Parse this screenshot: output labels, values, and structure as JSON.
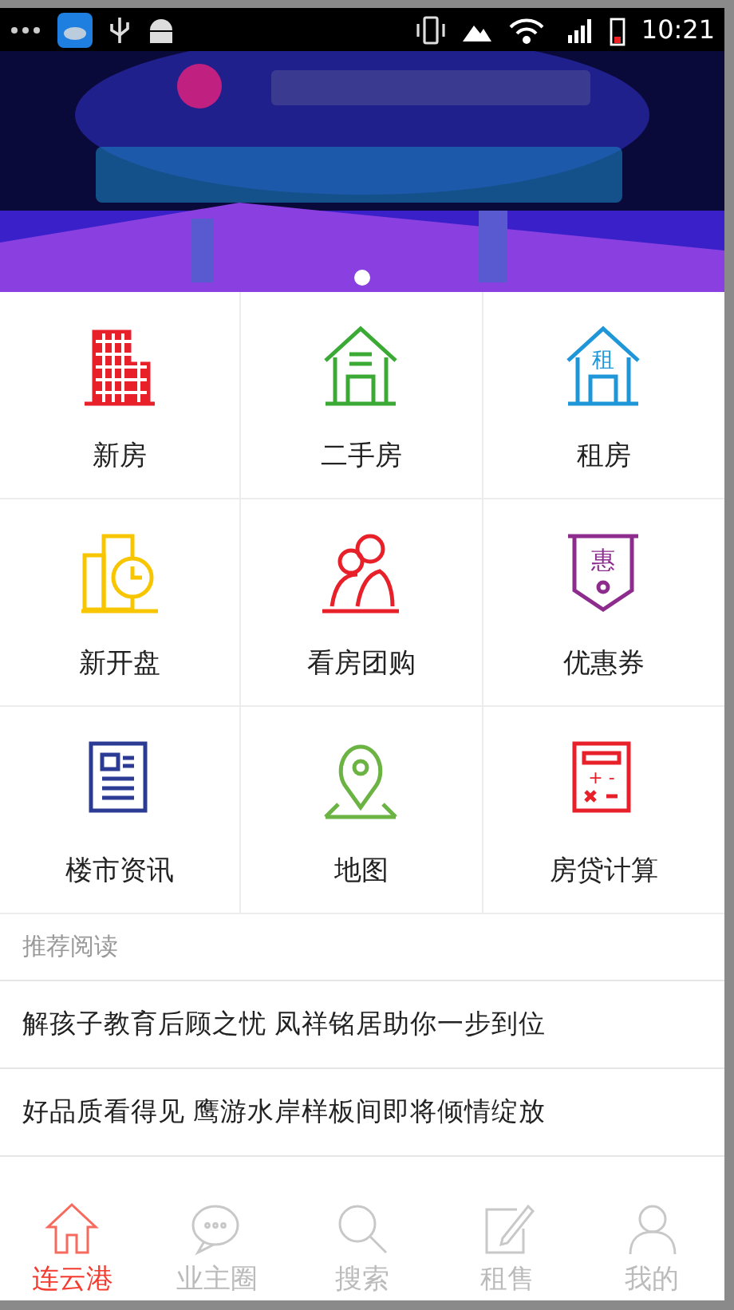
{
  "status_bar": {
    "time": "10:21"
  },
  "banner": {
    "kind": "picture",
    "pager": [
      {
        "selected": true
      }
    ]
  },
  "grid": [
    {
      "label": "新房",
      "kind": "building",
      "color": "#e8202a"
    },
    {
      "label": "二手房",
      "kind": "house",
      "color": "#3aaa35"
    },
    {
      "label": "租房",
      "kind": "rent-house",
      "color": "#1e96d8",
      "icon_text": "租"
    },
    {
      "label": "新开盘",
      "kind": "clock-building",
      "color": "#f7c600"
    },
    {
      "label": "看房团购",
      "kind": "group",
      "color": "#e8202a"
    },
    {
      "label": "优惠券",
      "kind": "coupon",
      "color": "#8e2c8e",
      "icon_text": "惠"
    },
    {
      "label": "楼市资讯",
      "kind": "news",
      "color": "#2b3a93"
    },
    {
      "label": "地图",
      "kind": "map-pin",
      "color": "#6bb343"
    },
    {
      "label": "房贷计算",
      "kind": "calculator",
      "color": "#e8202a",
      "icon_text": "+ -"
    }
  ],
  "reading": {
    "title": "推荐阅读",
    "articles": [
      "解孩子教育后顾之忧 凤祥铭居助你一步到位",
      "好品质看得见 鹰游水岸样板间即将倾情绽放"
    ]
  },
  "tab_bar": [
    {
      "label": "连云港",
      "kind": "home",
      "selected": true
    },
    {
      "label": "业主圈",
      "kind": "chat",
      "selected": false
    },
    {
      "label": "搜索",
      "kind": "search",
      "selected": false
    },
    {
      "label": "租售",
      "kind": "edit",
      "selected": false
    },
    {
      "label": "我的",
      "kind": "user",
      "selected": false
    }
  ]
}
